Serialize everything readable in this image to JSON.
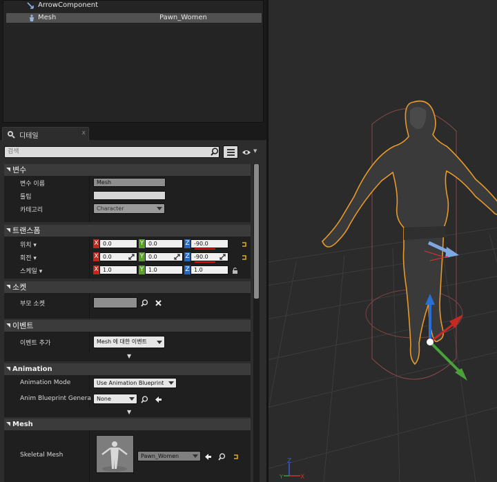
{
  "components": {
    "items": [
      {
        "name": "ArrowComponent",
        "asset": ""
      },
      {
        "name": "Mesh",
        "asset": "Pawn_Women"
      }
    ]
  },
  "details_tab": {
    "label": "디테일",
    "close": "x"
  },
  "search": {
    "placeholder": "검색"
  },
  "sections": {
    "variable": {
      "title": "변수",
      "name_label": "변수 이름",
      "name_value": "Mesh",
      "tooltip_label": "툴팁",
      "tooltip_value": "",
      "category_label": "카테고리",
      "category_value": "Character"
    },
    "transform": {
      "title": "트랜스폼",
      "location_label": "위치",
      "rotation_label": "회전",
      "scale_label": "스케일",
      "location": {
        "x": "0.0",
        "y": "0.0",
        "z": "-90.0"
      },
      "rotation": {
        "x": "0.0",
        "y": "0.0",
        "z": "-90.0"
      },
      "scale": {
        "x": "1.0",
        "y": "1.0",
        "z": "1.0"
      },
      "axis_x": "X",
      "axis_y": "Y",
      "axis_z": "Z"
    },
    "socket": {
      "title": "소켓",
      "parent_label": "부모 소켓",
      "parent_value": ""
    },
    "events": {
      "title": "이벤트",
      "add_label": "이벤트 추가",
      "add_value": "Mesh 에 대한 이벤트"
    },
    "animation": {
      "title": "Animation",
      "mode_label": "Animation Mode",
      "mode_value": "Use Animation Blueprint",
      "bp_label": "Anim Blueprint Generate",
      "bp_value": "None"
    },
    "mesh": {
      "title": "Mesh",
      "skeletal_label": "Skeletal Mesh",
      "skeletal_value": "Pawn_Women"
    }
  },
  "viewport": {
    "axis_z": "Z",
    "axis_y": "Y",
    "axis_x": "X"
  },
  "colors": {
    "axis_x": "#c0271d",
    "axis_y": "#5a9f2b",
    "axis_z": "#2168c9",
    "selection": "#f0a020"
  }
}
